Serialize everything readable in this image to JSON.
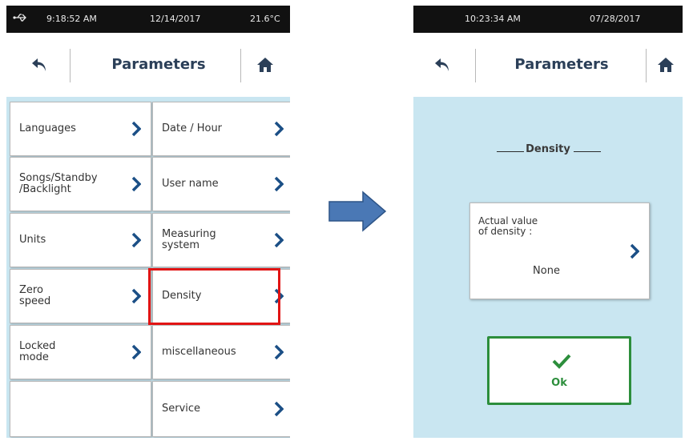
{
  "left_screen": {
    "status": {
      "usb_icon": "usb-icon",
      "time": "9:18:52 AM",
      "date": "12/14/2017",
      "temperature": "21.6°C"
    },
    "nav": {
      "back_icon": "back-arrow-icon",
      "title": "Parameters",
      "home_icon": "home-icon"
    },
    "menu": [
      {
        "label": "Languages"
      },
      {
        "label": "Date / Hour"
      },
      {
        "label": "Songs/Standby\n/Backlight"
      },
      {
        "label": "User name"
      },
      {
        "label": "Units"
      },
      {
        "label": "Measuring\nsystem"
      },
      {
        "label": "Zero\nspeed"
      },
      {
        "label": "Density"
      },
      {
        "label": "Locked\nmode"
      },
      {
        "label": "miscellaneous"
      },
      {
        "label": ""
      },
      {
        "label": "Service"
      }
    ],
    "highlighted_item": "Density",
    "highlight_color": "#e11414"
  },
  "transition": {
    "icon": "right-arrow-icon",
    "color": "#4a78b5"
  },
  "right_screen": {
    "status": {
      "time": "10:23:34 AM",
      "date": "07/28/2017"
    },
    "nav": {
      "back_icon": "back-arrow-icon",
      "title": "Parameters",
      "home_icon": "home-icon"
    },
    "section_title": "Density",
    "card": {
      "label": "Actual value\nof density :",
      "value": "None"
    },
    "ok_button": {
      "icon": "checkmark-icon",
      "label": "Ok",
      "color": "#2c8e3c"
    }
  },
  "colors": {
    "screen_bg": "#c9e6f1",
    "status_bg": "#111111",
    "chevron": "#1b4f86",
    "title": "#2b3f58"
  }
}
